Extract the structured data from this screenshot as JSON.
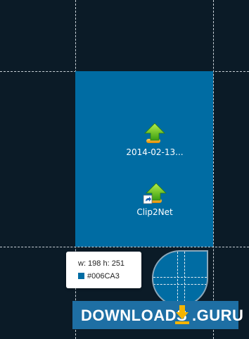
{
  "desktop_icons": [
    {
      "label": "2014-02-13...",
      "icon": "upload-arrow-icon"
    },
    {
      "label": "Clip2Net",
      "icon": "upload-arrow-shortcut-icon"
    }
  ],
  "capture_info": {
    "size_label": "w: 198  h: 251",
    "color_hex": "#006CA3"
  },
  "colors": {
    "selection": "#006CA3",
    "background": "#0b1b27"
  },
  "watermark": {
    "text_main": "DOWNLOADS",
    "text_suffix": ".GURU",
    "icon": "download-icon"
  }
}
